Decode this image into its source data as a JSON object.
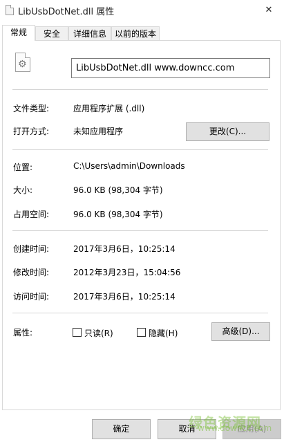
{
  "window": {
    "title": "LibUsbDotNet.dll 属性",
    "close_glyph": "✕"
  },
  "tabs": [
    {
      "label": "常规",
      "active": true
    },
    {
      "label": "安全",
      "active": false
    },
    {
      "label": "详细信息",
      "active": false
    },
    {
      "label": "以前的版本",
      "active": false
    }
  ],
  "general": {
    "file_name": "LibUsbDotNet.dll  www.downcc.com",
    "icon": "dll-file-icon",
    "file_type_label": "文件类型:",
    "file_type_value": "应用程序扩展 (.dll)",
    "opens_with_label": "打开方式:",
    "opens_with_value": "未知应用程序",
    "change_button": "更改(C)...",
    "location_label": "位置:",
    "location_value": "C:\\Users\\admin\\Downloads",
    "size_label": "大小:",
    "size_value": "96.0 KB (98,304 字节)",
    "size_on_disk_label": "占用空间:",
    "size_on_disk_value": "96.0 KB (98,304 字节)",
    "created_label": "创建时间:",
    "created_value": "2017年3月6日，10:25:14",
    "modified_label": "修改时间:",
    "modified_value": "2012年3月23日，15:04:56",
    "accessed_label": "访问时间:",
    "accessed_value": "2017年3月6日，10:25:14",
    "attributes_label": "属性:",
    "readonly_label": "只读(R)",
    "readonly_checked": false,
    "hidden_label": "隐藏(H)",
    "hidden_checked": false,
    "advanced_button": "高级(D)..."
  },
  "footer": {
    "ok": "确定",
    "cancel": "取消",
    "apply": "应用(A)",
    "apply_enabled": false
  },
  "watermark": {
    "text": "绿色资源网",
    "sub": "www.downcc.com"
  }
}
